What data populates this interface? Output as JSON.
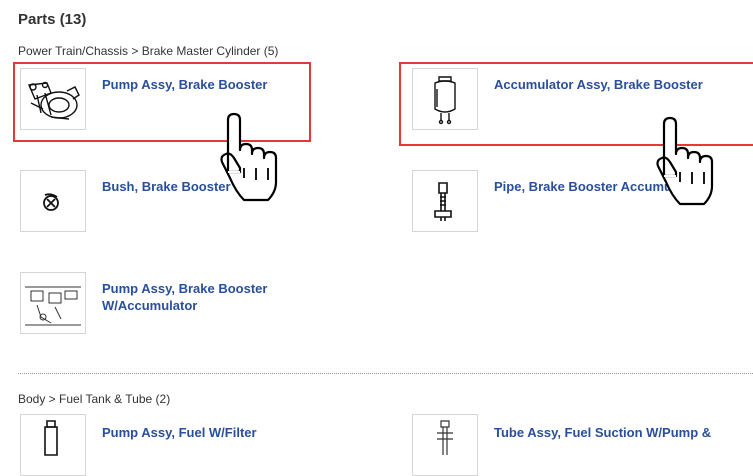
{
  "heading": "Parts (13)",
  "sections": [
    {
      "breadcrumb": "Power Train/Chassis > Brake Master Cylinder (5)",
      "parts": [
        {
          "name": "Pump Assy, Brake Booster",
          "icon": "brake-booster-pump-image"
        },
        {
          "name": "Accumulator Assy, Brake Booster",
          "icon": "accumulator-image"
        },
        {
          "name": "Bush, Brake Booster",
          "icon": "bush-image"
        },
        {
          "name": "Pipe, Brake Booster Accumulator",
          "icon": "pipe-bolt-image"
        },
        {
          "name": "Pump Assy, Brake Booster W/Accumulator",
          "line1": "Pump Assy, Brake Booster",
          "line2": "W/Accumulator",
          "icon": "pump-diagram-image"
        }
      ]
    },
    {
      "breadcrumb": "Body > Fuel Tank & Tube (2)",
      "parts": [
        {
          "name": "Pump Assy, Fuel W/Filter",
          "icon": "fuel-pump-image"
        },
        {
          "name": "Tube Assy, Fuel Suction W/Pump &",
          "icon": "fuel-tube-image"
        }
      ]
    }
  ],
  "colors": {
    "link": "#2a4f9a",
    "highlight": "#e53838",
    "text": "#333333"
  }
}
